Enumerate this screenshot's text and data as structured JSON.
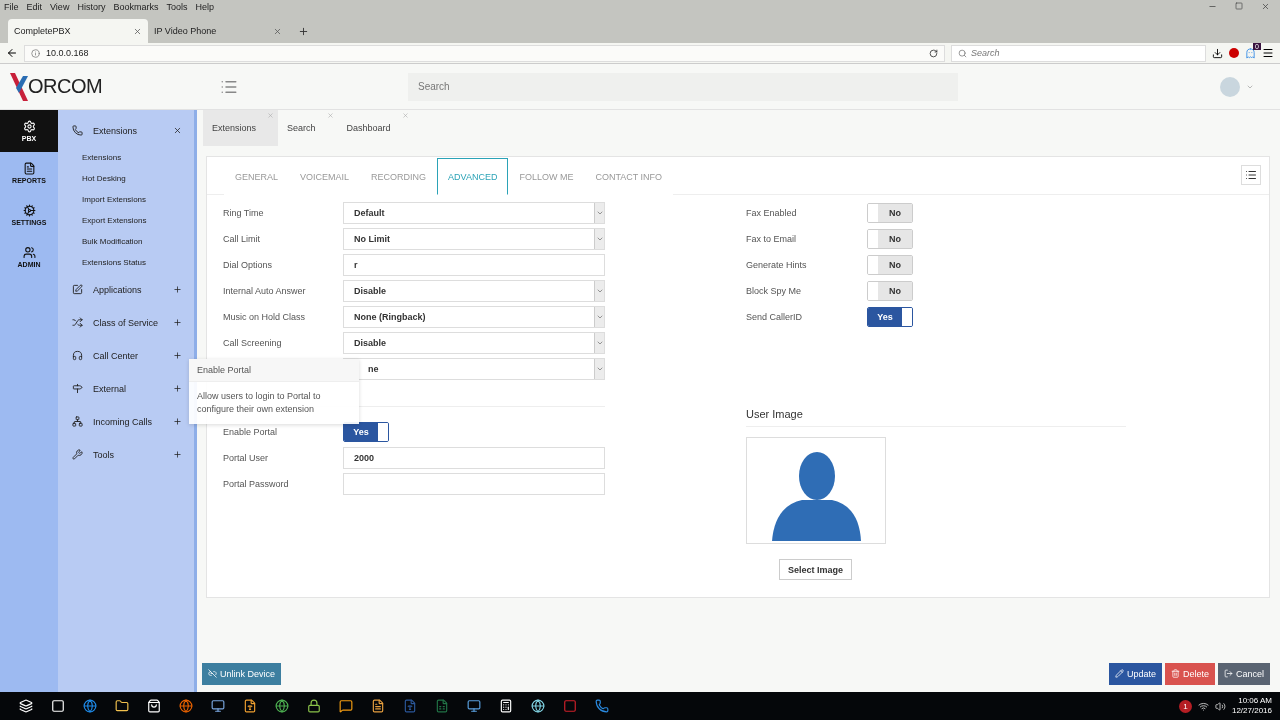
{
  "browser": {
    "menu": [
      "File",
      "Edit",
      "View",
      "History",
      "Bookmarks",
      "Tools",
      "Help"
    ],
    "tabs": [
      {
        "title": "CompletePBX",
        "selected": true
      },
      {
        "title": "IP Video Phone",
        "selected": false
      }
    ],
    "url": "10.0.0.168",
    "search": {
      "placeholder": "Search"
    },
    "badge": "0"
  },
  "header": {
    "logo": "ORCOM",
    "search": {
      "placeholder": "Search"
    }
  },
  "rail": [
    {
      "label": "PBX",
      "selected": true
    },
    {
      "label": "REPORTS",
      "selected": false
    },
    {
      "label": "SETTINGS",
      "selected": false
    },
    {
      "label": "ADMIN",
      "selected": false
    }
  ],
  "menu": [
    {
      "label": "Extensions",
      "expanded": true,
      "children": [
        {
          "label": "Extensions"
        },
        {
          "label": "Hot Desking"
        },
        {
          "label": "Import Extensions"
        },
        {
          "label": "Export Extensions"
        },
        {
          "label": "Bulk Modification"
        },
        {
          "label": "Extensions Status"
        }
      ]
    },
    {
      "label": "Applications",
      "expanded": false
    },
    {
      "label": "Class of Service",
      "expanded": false
    },
    {
      "label": "Call Center",
      "expanded": false
    },
    {
      "label": "External",
      "expanded": false
    },
    {
      "label": "Incoming Calls",
      "expanded": false
    },
    {
      "label": "Tools",
      "expanded": false
    }
  ],
  "page_tabs": [
    {
      "label": "Extensions",
      "selected": true
    },
    {
      "label": "Search",
      "selected": false
    },
    {
      "label": "Dashboard",
      "selected": false
    }
  ],
  "sub_tabs": [
    {
      "label": "GENERAL",
      "selected": false
    },
    {
      "label": "VOICEMAIL",
      "selected": false
    },
    {
      "label": "RECORDING",
      "selected": false
    },
    {
      "label": "ADVANCED",
      "selected": true
    },
    {
      "label": "FOLLOW ME",
      "selected": false
    },
    {
      "label": "CONTACT INFO",
      "selected": false
    }
  ],
  "left_fields": [
    {
      "kind": "select",
      "label": "Ring Time",
      "value": "Default"
    },
    {
      "kind": "select",
      "label": "Call Limit",
      "value": "No Limit"
    },
    {
      "kind": "text",
      "label": "Dial Options",
      "value": "r"
    },
    {
      "kind": "select",
      "label": "Internal Auto Answer",
      "value": "Disable"
    },
    {
      "kind": "select",
      "label": "Music on Hold Class",
      "value": "None (Ringback)"
    },
    {
      "kind": "select",
      "label": "Call Screening",
      "value": "Disable"
    },
    {
      "kind": "select",
      "value": "ne"
    }
  ],
  "portal_fields": [
    {
      "kind": "toggle",
      "label": "Enable Portal",
      "on": true,
      "value": "Yes"
    },
    {
      "kind": "text",
      "label": "Portal User",
      "value": "2000"
    },
    {
      "kind": "text",
      "label": "Portal Password"
    }
  ],
  "right_fields": [
    {
      "label": "Fax Enabled",
      "on": false,
      "value": "No"
    },
    {
      "label": "Fax to Email",
      "on": false,
      "value": "No"
    },
    {
      "label": "Generate Hints",
      "on": false,
      "value": "No"
    },
    {
      "label": "Block Spy Me",
      "on": false,
      "value": "No"
    },
    {
      "label": "Send CallerID",
      "on": true,
      "value": "Yes"
    }
  ],
  "user_image": {
    "title": "User Image",
    "button": "Select Image"
  },
  "tooltip": {
    "title": "Enable Portal",
    "text": "Allow users to login to Portal to configure their own extension"
  },
  "footer": {
    "left": [
      {
        "label": "Unlink Device",
        "kind": "unlink"
      }
    ],
    "right": [
      {
        "label": "Update",
        "kind": "update"
      },
      {
        "label": "Delete",
        "kind": "delete"
      },
      {
        "label": "Cancel",
        "kind": "cancel"
      }
    ]
  },
  "taskbar": {
    "tray_badge": "1",
    "time": "10:06 AM",
    "date": "12/27/2016"
  }
}
